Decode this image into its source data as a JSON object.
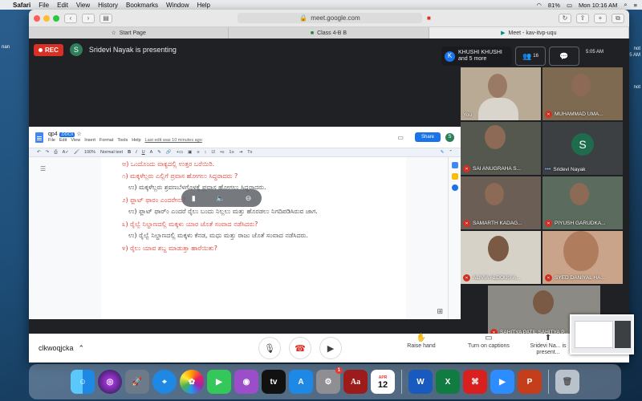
{
  "menubar": {
    "app": "Safari",
    "menus": [
      "File",
      "Edit",
      "View",
      "History",
      "Bookmarks",
      "Window",
      "Help"
    ],
    "battery": "81%",
    "clock": "Mon 10:16 AM"
  },
  "browser": {
    "url": "meet.google.com",
    "tabs": [
      {
        "label": "Start Page",
        "active": false
      },
      {
        "label": "Class 4-B B",
        "active": false
      },
      {
        "label": "Meet - kav-itvp-uqu",
        "active": true
      }
    ]
  },
  "meet": {
    "rec_label": "REC",
    "presenter_initial": "S",
    "presenting_text": "Sridevi Nayak is presenting",
    "chat_user_initial": "K",
    "chat_user_name": "KHUSHI KHUSHI",
    "chat_user_sub": "and 5 more",
    "participants_count": "16",
    "chat_time": "5:05 AM"
  },
  "doc": {
    "title": "qp4",
    "format": ".DOCX",
    "menu": [
      "File",
      "Edit",
      "View",
      "Insert",
      "Format",
      "Tools",
      "Help"
    ],
    "last_edit": "Last edit was 10 minutes ago",
    "share": "Share",
    "user_initial": "S",
    "zoom": "100%",
    "style": "Normal text",
    "lines": [
      {
        "kind": "q",
        "text": "ಅ) ಒಂದೊಂದು ವಾಕ್ಯದಲ್ಲಿ ಉತ್ತರ ಬರೆಯಿರಿ."
      },
      {
        "kind": "q",
        "text": "೧)  ಮಕ್ಕಳೆಲ್ಲರು ಎಲ್ಲಿಗೆ ಪ್ರವಾಸ ಹೋಗಲು ಸಿದ್ಧರಾದರು ?"
      },
      {
        "kind": "a",
        "text": "ಉ)  ಮಕ್ಕಳೆಲ್ಲರು ಶ್ರವಣಬೆಳಗೊಳಕ್ಕೆ ಪ್ರವಾಸ ಹೋಗಲು ಸಿದ್ಧರಾದರು."
      },
      {
        "kind": "q",
        "text": "೨)  ಫ್ಲಾಟ್ ಫಾರಂ ಎಂದರೇನು?"
      },
      {
        "kind": "a",
        "text": "ಉ)  ಫ್ಲಾಟ್ ಫಾರ್ಂ ಎಂದರೆ ರೈಲು ಬಂದು ನಿಲ್ಲಲು ಮತ್ತು ಹೊರಡಲು ನಿಗದಿಪಡಿಸಿರುವ ಜಾಗ."
      },
      {
        "kind": "q",
        "text": "೩)  ರೈಲ್ವೆ ನಿಲ್ದಾಣದಲ್ಲಿ ಮಕ್ಕಳು ಯಾರ ಜೊತೆ ಸಂವಾದ ನಡೆಸಿದರು?"
      },
      {
        "kind": "a",
        "text": "ಉ)  ರೈಲ್ವೆ ನಿಲ್ದಾಣದಲ್ಲಿ ಮಕ್ಕಳು ಕೆನಡ, ಮಧು ಮತ್ತು ರಾಜು ಜೊತೆ ಸಂವಾದ ನಡೆಸಿದರು."
      },
      {
        "kind": "q",
        "text": "೪)  ರೈಲು ಯಾವ ಶಬ್ದ ಮಾಡುತ್ತಾ ಹಾರೆಯಿತು?"
      }
    ]
  },
  "participants": [
    {
      "name": "You",
      "muted": false,
      "avatar": ""
    },
    {
      "name": "MUHAMMAD UMA...",
      "muted": true,
      "avatar": ""
    },
    {
      "name": "SAI ANUGRAHA S...",
      "muted": true,
      "avatar": ""
    },
    {
      "name": "Sridevi Nayak",
      "muted": false,
      "avatar": "S"
    },
    {
      "name": "SAMARTH KADAG...",
      "muted": true,
      "avatar": ""
    },
    {
      "name": "PIYUSH GARUDKA...",
      "muted": true,
      "avatar": ""
    },
    {
      "name": "ALIVIA ALDOUS A...",
      "muted": true,
      "avatar": ""
    },
    {
      "name": "SYED DANIYAL HA...",
      "muted": true,
      "avatar": ""
    },
    {
      "name": "SAHITYA PATIL SAHITYA P...",
      "muted": true,
      "avatar": ""
    }
  ],
  "bottom": {
    "meeting_code": "clkwoqjcka",
    "raise_hand": "Raise hand",
    "captions": "Turn on captions",
    "present": "Sridevi Na... is present..."
  },
  "desktop": {
    "left_label": "nan",
    "right_labels": [
      "not",
      "05 AM",
      "not"
    ],
    "dock_badge": "1",
    "calendar_month": "APR",
    "calendar_day": "12"
  }
}
